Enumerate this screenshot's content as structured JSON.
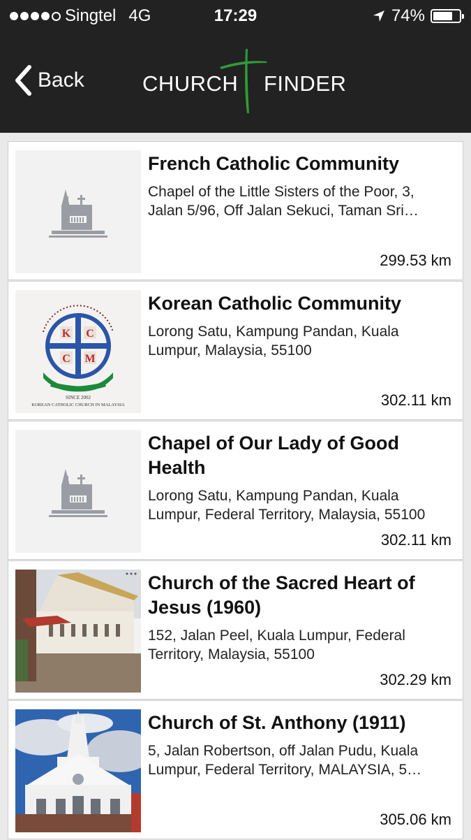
{
  "status_bar": {
    "carrier": "Singtel",
    "network": "4G",
    "time": "17:29",
    "battery": "74%",
    "battery_level": 0.74,
    "icons": [
      "signal-dots-icon",
      "location-arrow-icon",
      "battery-icon"
    ]
  },
  "nav": {
    "back_label": "Back",
    "logo_word_1": "CHURCH",
    "logo_word_2": "FINDER",
    "logo_cross_color": "#2e9b3a"
  },
  "churches": [
    {
      "name": "French Catholic Community",
      "address": "Chapel of the Little Sisters of the Poor, 3, Jalan 5/96, Off Jalan Sekuci, Taman Sri…",
      "distance": "299.53 km",
      "thumb": "placeholder-church-icon"
    },
    {
      "name": "Korean Catholic Community",
      "address": "Lorong Satu, Kampung Pandan, Kuala Lumpur, Malaysia, 55100",
      "distance": "302.11 km",
      "thumb": "kccm-logo",
      "logo_letters": [
        "K",
        "C",
        "C",
        "M"
      ],
      "logo_since": "SINCE 2002",
      "logo_caption": "KOREAN CATHOLIC CHURCH IN MALAYSIA"
    },
    {
      "name": "Chapel of Our Lady of Good Health",
      "address": "Lorong Satu, Kampung Pandan, Kuala Lumpur, Federal Territory, Malaysia, 55100",
      "distance": "302.11 km",
      "thumb": "placeholder-church-icon"
    },
    {
      "name": "Church of the Sacred Heart of Jesus (1960)",
      "address": "152, Jalan Peel, Kuala Lumpur, Federal Territory, Malaysia, 55100",
      "distance": "302.29 km",
      "thumb": "photo-sacred-heart"
    },
    {
      "name": "Church of St. Anthony (1911)",
      "address": "5, Jalan Robertson, off Jalan Pudu, Kuala Lumpur, Federal Territory, MALAYSIA, 5…",
      "distance": "305.06 km",
      "thumb": "photo-st-anthony"
    }
  ],
  "colors": {
    "header_bg": "#222222",
    "page_bg": "#e9e9e9",
    "placeholder_icon": "#9a9ea4"
  }
}
